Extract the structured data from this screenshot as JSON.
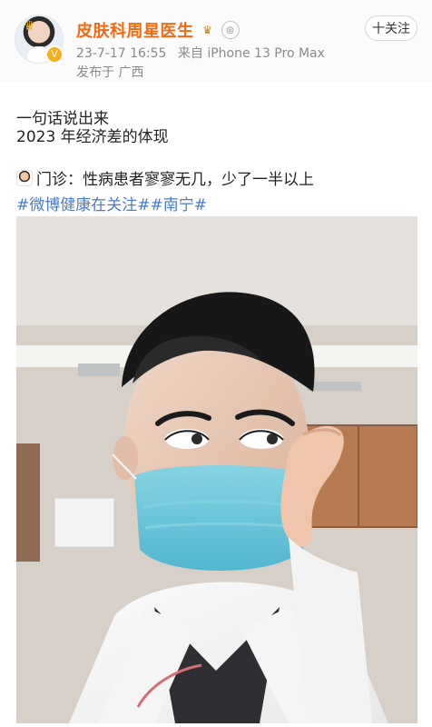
{
  "header": {
    "username": "皮肤科周星医生",
    "timestamp": "23-7-17 16:55",
    "source": "来自 iPhone 13 Pro Max",
    "location": "发布于 广西",
    "follow_label": "十关注"
  },
  "post": {
    "line1": "一句话说出来",
    "line2": "2023 年经济差的体现",
    "line3": "门诊：性病患者寥寥无几，少了一半以上",
    "hashtags": "#微博健康在关注##南宁#"
  }
}
